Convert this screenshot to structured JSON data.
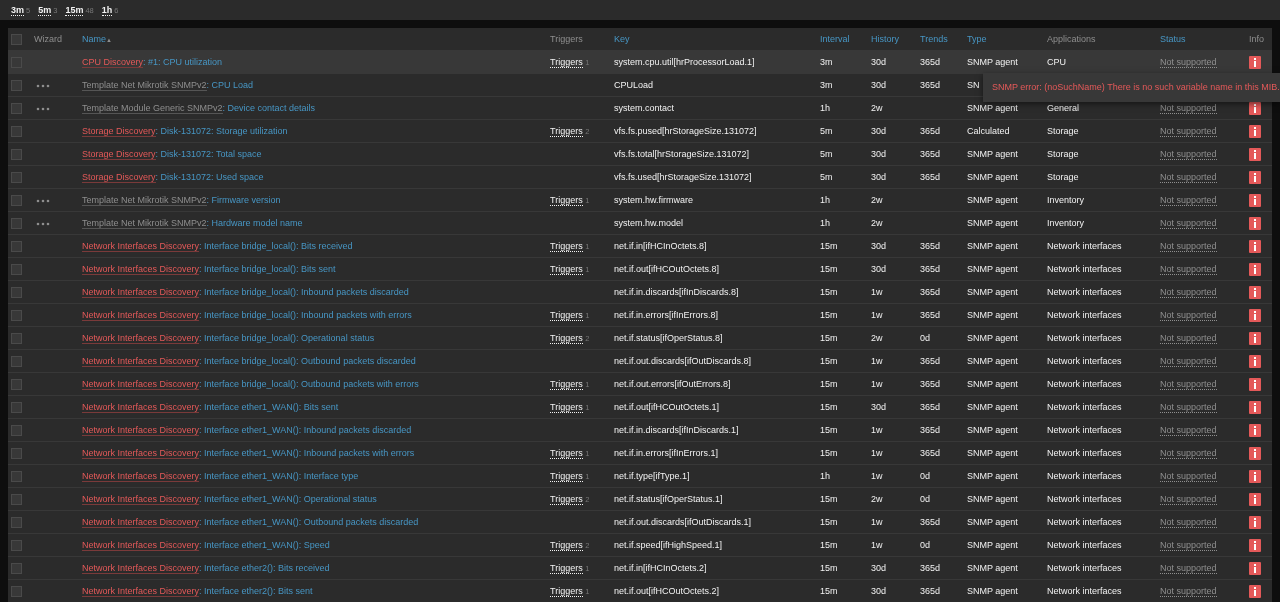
{
  "filters": [
    {
      "label": "3m",
      "count": "5"
    },
    {
      "label": "5m",
      "count": "3"
    },
    {
      "label": "15m",
      "count": "48"
    },
    {
      "label": "1h",
      "count": "6"
    }
  ],
  "table": {
    "select_all": {
      "checked": false
    },
    "columns": [
      {
        "label": "Wizard",
        "sortable": false
      },
      {
        "label": "Name",
        "sortable": true,
        "sort": "▲"
      },
      {
        "label": "Triggers",
        "sortable": false
      },
      {
        "label": "Key",
        "sortable": true
      },
      {
        "label": "Interval",
        "sortable": true
      },
      {
        "label": "History",
        "sortable": true
      },
      {
        "label": "Trends",
        "sortable": true
      },
      {
        "label": "Type",
        "sortable": true
      },
      {
        "label": "Applications",
        "sortable": false
      },
      {
        "label": "Status",
        "sortable": true
      },
      {
        "label": "Info",
        "sortable": false
      }
    ],
    "rows": [
      {
        "checked": false,
        "hovered": true,
        "wizard": false,
        "prefix": {
          "kind": "discovery",
          "text": "CPU Discovery"
        },
        "name": ": #1: CPU utilization",
        "triggers": {
          "label": "Triggers",
          "count": "1"
        },
        "key": "system.cpu.util[hrProcessorLoad.1]",
        "interval": "3m",
        "history": "30d",
        "trends": "365d",
        "type": "SNMP agent",
        "application": "CPU",
        "status": "Not supported"
      },
      {
        "checked": false,
        "hovered": false,
        "wizard": true,
        "prefix": {
          "kind": "template",
          "text": "Template Net Mikrotik SNMPv2"
        },
        "name": ": CPU Load",
        "key": "CPULoad",
        "interval": "3m",
        "history": "30d",
        "trends": "365d",
        "type": "SN"
      },
      {
        "checked": false,
        "hovered": false,
        "wizard": true,
        "prefix": {
          "kind": "template",
          "text": "Template Module Generic SNMPv2"
        },
        "name": ": Device contact details",
        "key": "system.contact",
        "interval": "1h",
        "history": "2w",
        "type": "SNMP agent",
        "application": "General",
        "status": "Not supported"
      },
      {
        "checked": false,
        "hovered": false,
        "wizard": false,
        "prefix": {
          "kind": "discovery",
          "text": "Storage Discovery"
        },
        "name": ": Disk-131072: Storage utilization",
        "triggers": {
          "label": "Triggers",
          "count": "2"
        },
        "key": "vfs.fs.pused[hrStorageSize.131072]",
        "interval": "5m",
        "history": "30d",
        "trends": "365d",
        "type": "Calculated",
        "application": "Storage",
        "status": "Not supported"
      },
      {
        "checked": false,
        "hovered": false,
        "wizard": false,
        "prefix": {
          "kind": "discovery",
          "text": "Storage Discovery"
        },
        "name": ": Disk-131072: Total space",
        "key": "vfs.fs.total[hrStorageSize.131072]",
        "interval": "5m",
        "history": "30d",
        "trends": "365d",
        "type": "SNMP agent",
        "application": "Storage",
        "status": "Not supported"
      },
      {
        "checked": false,
        "hovered": false,
        "wizard": false,
        "prefix": {
          "kind": "discovery",
          "text": "Storage Discovery"
        },
        "name": ": Disk-131072: Used space",
        "key": "vfs.fs.used[hrStorageSize.131072]",
        "interval": "5m",
        "history": "30d",
        "trends": "365d",
        "type": "SNMP agent",
        "application": "Storage",
        "status": "Not supported"
      },
      {
        "checked": false,
        "hovered": false,
        "wizard": true,
        "prefix": {
          "kind": "template",
          "text": "Template Net Mikrotik SNMPv2"
        },
        "name": ": Firmware version",
        "triggers": {
          "label": "Triggers",
          "count": "1"
        },
        "key": "system.hw.firmware",
        "interval": "1h",
        "history": "2w",
        "type": "SNMP agent",
        "application": "Inventory",
        "status": "Not supported"
      },
      {
        "checked": false,
        "hovered": false,
        "wizard": true,
        "prefix": {
          "kind": "template",
          "text": "Template Net Mikrotik SNMPv2"
        },
        "name": ": Hardware model name",
        "key": "system.hw.model",
        "interval": "1h",
        "history": "2w",
        "type": "SNMP agent",
        "application": "Inventory",
        "status": "Not supported"
      },
      {
        "checked": false,
        "hovered": false,
        "wizard": false,
        "prefix": {
          "kind": "discovery",
          "text": "Network Interfaces Discovery"
        },
        "name": ": Interface bridge_local(): Bits received",
        "triggers": {
          "label": "Triggers",
          "count": "1"
        },
        "key": "net.if.in[ifHCInOctets.8]",
        "interval": "15m",
        "history": "30d",
        "trends": "365d",
        "type": "SNMP agent",
        "application": "Network interfaces",
        "status": "Not supported"
      },
      {
        "checked": false,
        "hovered": false,
        "wizard": false,
        "prefix": {
          "kind": "discovery",
          "text": "Network Interfaces Discovery"
        },
        "name": ": Interface bridge_local(): Bits sent",
        "triggers": {
          "label": "Triggers",
          "count": "1"
        },
        "key": "net.if.out[ifHCOutOctets.8]",
        "interval": "15m",
        "history": "30d",
        "trends": "365d",
        "type": "SNMP agent",
        "application": "Network interfaces",
        "status": "Not supported"
      },
      {
        "checked": false,
        "hovered": false,
        "wizard": false,
        "prefix": {
          "kind": "discovery",
          "text": "Network Interfaces Discovery"
        },
        "name": ": Interface bridge_local(): Inbound packets discarded",
        "key": "net.if.in.discards[ifInDiscards.8]",
        "interval": "15m",
        "history": "1w",
        "trends": "365d",
        "type": "SNMP agent",
        "application": "Network interfaces",
        "status": "Not supported"
      },
      {
        "checked": false,
        "hovered": false,
        "wizard": false,
        "prefix": {
          "kind": "discovery",
          "text": "Network Interfaces Discovery"
        },
        "name": ": Interface bridge_local(): Inbound packets with errors",
        "triggers": {
          "label": "Triggers",
          "count": "1"
        },
        "key": "net.if.in.errors[ifInErrors.8]",
        "interval": "15m",
        "history": "1w",
        "trends": "365d",
        "type": "SNMP agent",
        "application": "Network interfaces",
        "status": "Not supported"
      },
      {
        "checked": false,
        "hovered": false,
        "wizard": false,
        "prefix": {
          "kind": "discovery",
          "text": "Network Interfaces Discovery"
        },
        "name": ": Interface bridge_local(): Operational status",
        "triggers": {
          "label": "Triggers",
          "count": "2"
        },
        "key": "net.if.status[ifOperStatus.8]",
        "interval": "15m",
        "history": "2w",
        "trends": "0d",
        "type": "SNMP agent",
        "application": "Network interfaces",
        "status": "Not supported"
      },
      {
        "checked": false,
        "hovered": false,
        "wizard": false,
        "prefix": {
          "kind": "discovery",
          "text": "Network Interfaces Discovery"
        },
        "name": ": Interface bridge_local(): Outbound packets discarded",
        "key": "net.if.out.discards[ifOutDiscards.8]",
        "interval": "15m",
        "history": "1w",
        "trends": "365d",
        "type": "SNMP agent",
        "application": "Network interfaces",
        "status": "Not supported"
      },
      {
        "checked": false,
        "hovered": false,
        "wizard": false,
        "prefix": {
          "kind": "discovery",
          "text": "Network Interfaces Discovery"
        },
        "name": ": Interface bridge_local(): Outbound packets with errors",
        "triggers": {
          "label": "Triggers",
          "count": "1"
        },
        "key": "net.if.out.errors[ifOutErrors.8]",
        "interval": "15m",
        "history": "1w",
        "trends": "365d",
        "type": "SNMP agent",
        "application": "Network interfaces",
        "status": "Not supported"
      },
      {
        "checked": false,
        "hovered": false,
        "wizard": false,
        "prefix": {
          "kind": "discovery",
          "text": "Network Interfaces Discovery"
        },
        "name": ": Interface ether1_WAN(): Bits sent",
        "triggers": {
          "label": "Triggers",
          "count": "1"
        },
        "key": "net.if.out[ifHCOutOctets.1]",
        "interval": "15m",
        "history": "30d",
        "trends": "365d",
        "type": "SNMP agent",
        "application": "Network interfaces",
        "status": "Not supported"
      },
      {
        "checked": false,
        "hovered": false,
        "wizard": false,
        "prefix": {
          "kind": "discovery",
          "text": "Network Interfaces Discovery"
        },
        "name": ": Interface ether1_WAN(): Inbound packets discarded",
        "key": "net.if.in.discards[ifInDiscards.1]",
        "interval": "15m",
        "history": "1w",
        "trends": "365d",
        "type": "SNMP agent",
        "application": "Network interfaces",
        "status": "Not supported"
      },
      {
        "checked": false,
        "hovered": false,
        "wizard": false,
        "prefix": {
          "kind": "discovery",
          "text": "Network Interfaces Discovery"
        },
        "name": ": Interface ether1_WAN(): Inbound packets with errors",
        "triggers": {
          "label": "Triggers",
          "count": "1"
        },
        "key": "net.if.in.errors[ifInErrors.1]",
        "interval": "15m",
        "history": "1w",
        "trends": "365d",
        "type": "SNMP agent",
        "application": "Network interfaces",
        "status": "Not supported"
      },
      {
        "checked": false,
        "hovered": false,
        "wizard": false,
        "prefix": {
          "kind": "discovery",
          "text": "Network Interfaces Discovery"
        },
        "name": ": Interface ether1_WAN(): Interface type",
        "triggers": {
          "label": "Triggers",
          "count": "1"
        },
        "key": "net.if.type[ifType.1]",
        "interval": "1h",
        "history": "1w",
        "trends": "0d",
        "type": "SNMP agent",
        "application": "Network interfaces",
        "status": "Not supported"
      },
      {
        "checked": false,
        "hovered": false,
        "wizard": false,
        "prefix": {
          "kind": "discovery",
          "text": "Network Interfaces Discovery"
        },
        "name": ": Interface ether1_WAN(): Operational status",
        "triggers": {
          "label": "Triggers",
          "count": "2"
        },
        "key": "net.if.status[ifOperStatus.1]",
        "interval": "15m",
        "history": "2w",
        "trends": "0d",
        "type": "SNMP agent",
        "application": "Network interfaces",
        "status": "Not supported"
      },
      {
        "checked": false,
        "hovered": false,
        "wizard": false,
        "prefix": {
          "kind": "discovery",
          "text": "Network Interfaces Discovery"
        },
        "name": ": Interface ether1_WAN(): Outbound packets discarded",
        "key": "net.if.out.discards[ifOutDiscards.1]",
        "interval": "15m",
        "history": "1w",
        "trends": "365d",
        "type": "SNMP agent",
        "application": "Network interfaces",
        "status": "Not supported"
      },
      {
        "checked": false,
        "hovered": false,
        "wizard": false,
        "prefix": {
          "kind": "discovery",
          "text": "Network Interfaces Discovery"
        },
        "name": ": Interface ether1_WAN(): Speed",
        "triggers": {
          "label": "Triggers",
          "count": "2"
        },
        "key": "net.if.speed[ifHighSpeed.1]",
        "interval": "15m",
        "history": "1w",
        "trends": "0d",
        "type": "SNMP agent",
        "application": "Network interfaces",
        "status": "Not supported"
      },
      {
        "checked": false,
        "hovered": false,
        "wizard": false,
        "prefix": {
          "kind": "discovery",
          "text": "Network Interfaces Discovery"
        },
        "name": ": Interface ether2(): Bits received",
        "triggers": {
          "label": "Triggers",
          "count": "1"
        },
        "key": "net.if.in[ifHCInOctets.2]",
        "interval": "15m",
        "history": "30d",
        "trends": "365d",
        "type": "SNMP agent",
        "application": "Network interfaces",
        "status": "Not supported"
      },
      {
        "checked": false,
        "hovered": false,
        "wizard": false,
        "prefix": {
          "kind": "discovery",
          "text": "Network Interfaces Discovery"
        },
        "name": ": Interface ether2(): Bits sent",
        "triggers": {
          "label": "Triggers",
          "count": "1"
        },
        "key": "net.if.out[ifHCOutOctets.2]",
        "interval": "15m",
        "history": "30d",
        "trends": "365d",
        "type": "SNMP agent",
        "application": "Network interfaces",
        "status": "Not supported"
      }
    ]
  },
  "tooltip": {
    "text": "SNMP error: (noSuchName) There is no such variable name in this MIB."
  }
}
